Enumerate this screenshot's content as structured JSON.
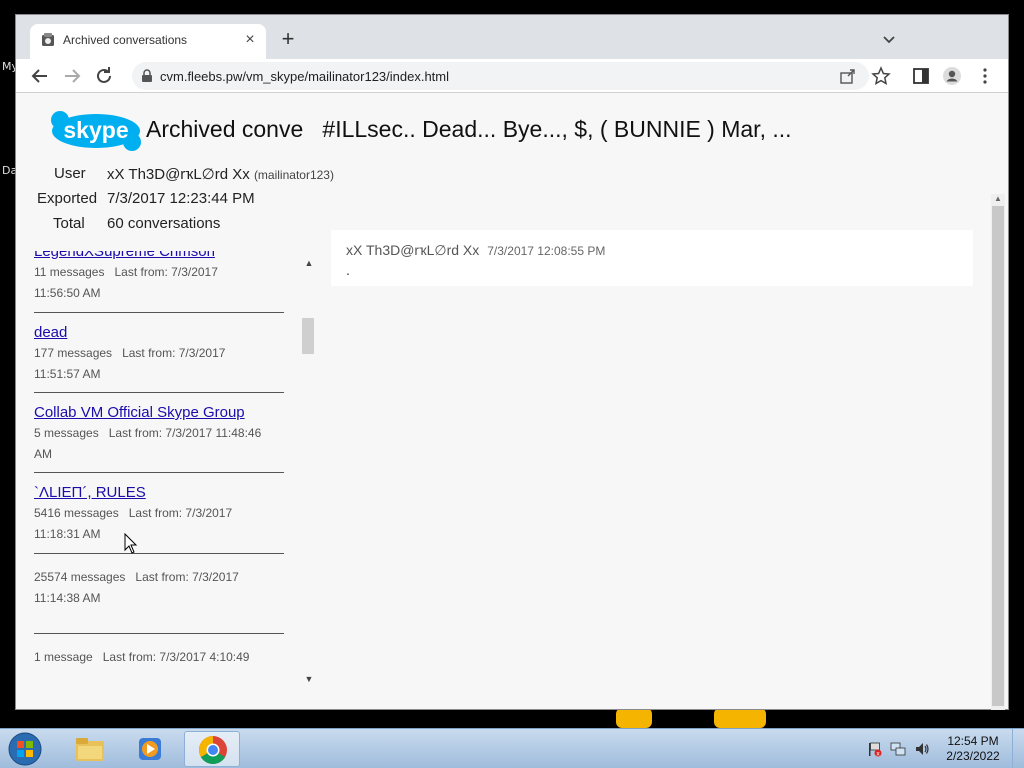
{
  "desktop": {
    "label_top": "My",
    "label_mid": "Da"
  },
  "browser": {
    "tab_title": "Archived conversations",
    "address": "cvm.fleebs.pw/vm_skype/mailinator123/index.html"
  },
  "page": {
    "title": "Archived conve   #ILLsec.. Dead... Bye..., $, ( BUNNIE ) Mar, ...",
    "logo_text": "skype",
    "user_label": "User",
    "user_value": "xX Th3D@rҡL∅rԁ Xx",
    "user_sub": "(mailinator123)",
    "exported_label": "Exported",
    "exported_value": "7/3/2017 12:23:44 PM",
    "total_label": "Total",
    "total_value": "60 conversations"
  },
  "conversations": [
    {
      "title": "LegendXSupreme Crimson",
      "count": "11 messages",
      "last": "Last from: 7/3/2017",
      "time": "11:56:50 AM"
    },
    {
      "title": "dead",
      "count": "177 messages",
      "last": "Last from: 7/3/2017",
      "time": "11:51:57 AM"
    },
    {
      "title": "Collab VM Official Skype Group",
      "count": "5 messages",
      "last": "Last from: 7/3/2017 11:48:46",
      "time": "AM"
    },
    {
      "title": "`ΛLIEΠ´, RULES",
      "count": "5416 messages",
      "last": "Last from: 7/3/2017",
      "time": "11:18:31 AM"
    },
    {
      "title": "",
      "count": "25574 messages",
      "last": "Last from: 7/3/2017",
      "time": "11:14:38 AM"
    },
    {
      "title": "",
      "count": "1 message",
      "last": "Last from: 7/3/2017 4:10:49",
      "time": ""
    }
  ],
  "message": {
    "author": "xX Th3D@rҡL∅rԁ Xx",
    "time": "7/3/2017 12:08:55 PM",
    "text": "."
  },
  "taskbar": {
    "clock_time": "12:54 PM",
    "clock_date": "2/23/2022",
    "apps": [
      "start",
      "explorer",
      "media-player",
      "chrome"
    ]
  },
  "colors": {
    "link": "#1a0dab",
    "taskbar": "#b4cde8",
    "tab_bg": "#dee1e6"
  }
}
